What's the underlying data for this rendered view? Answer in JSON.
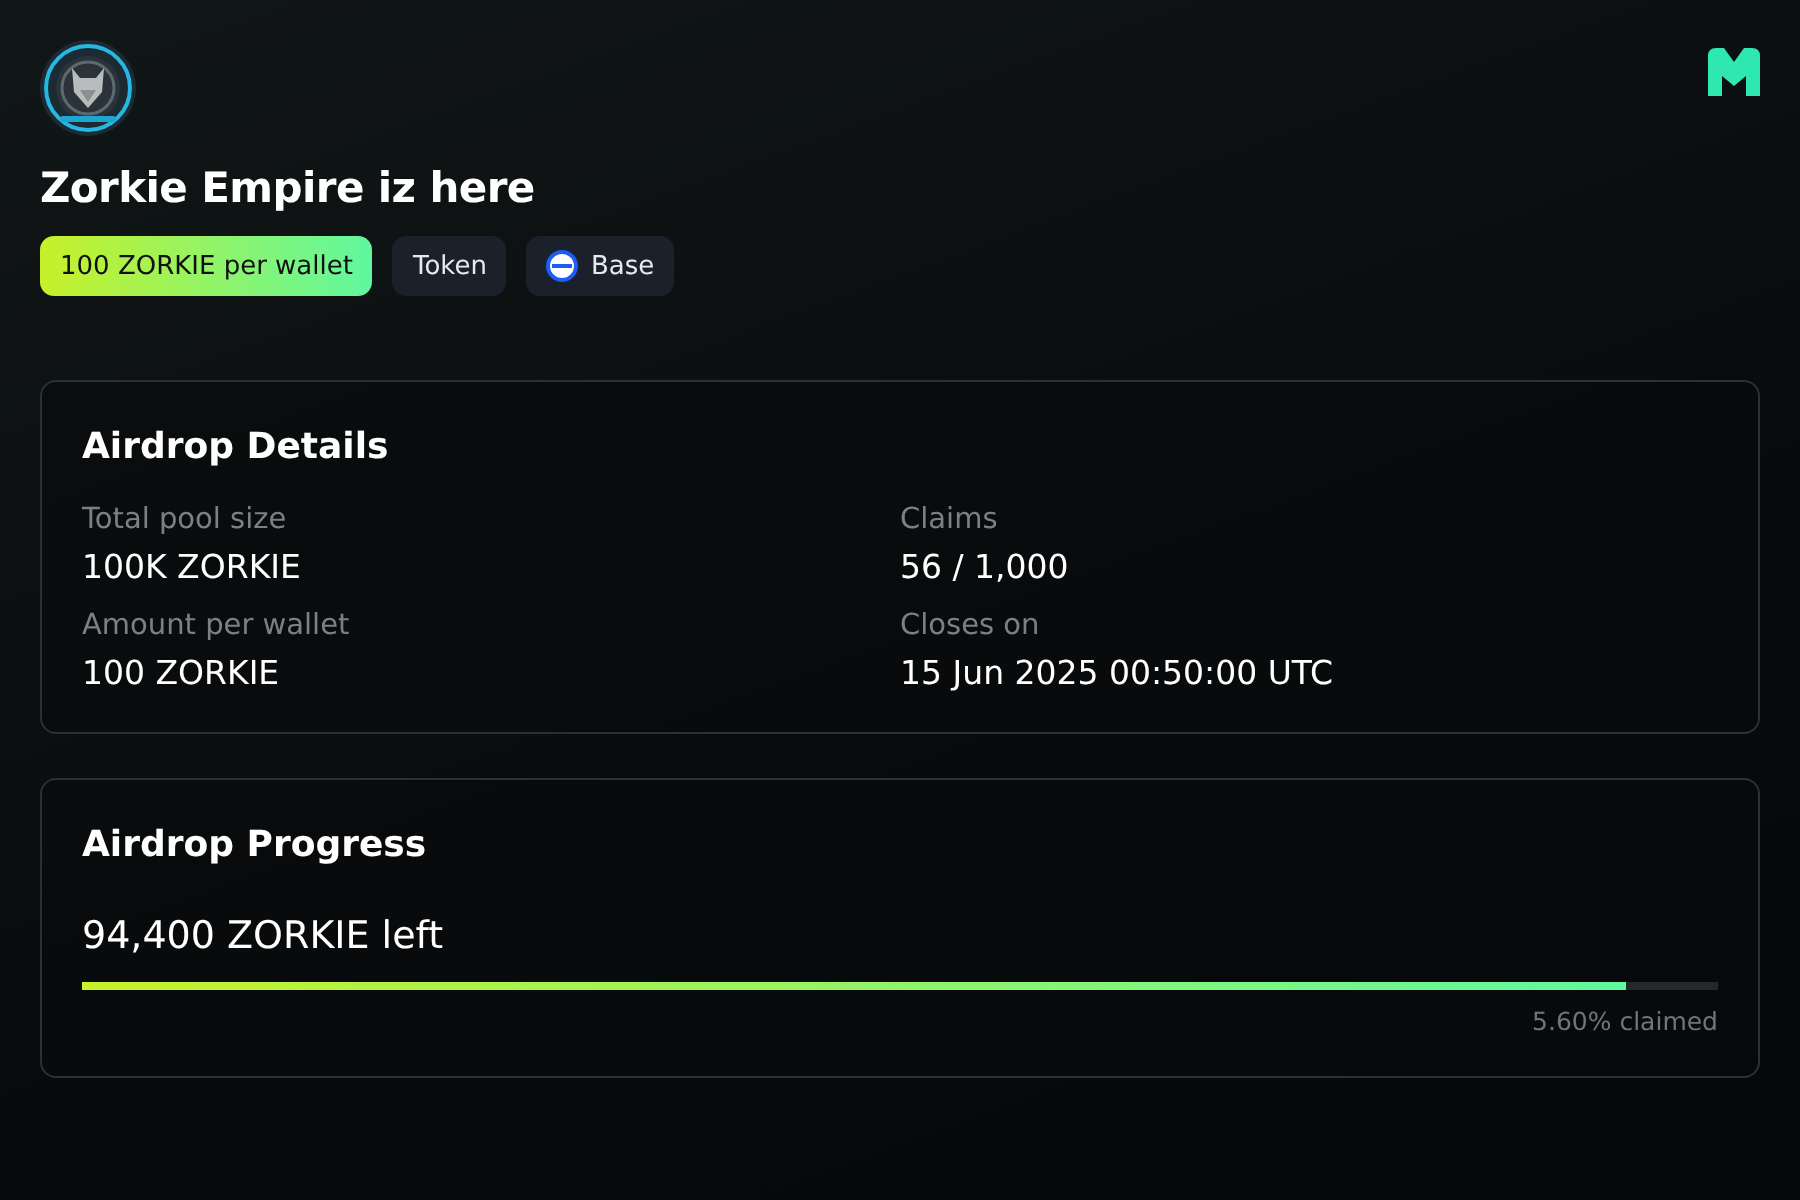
{
  "header": {
    "title": "Zorkie Empire iz here",
    "tags": [
      {
        "kind": "highlight",
        "label": "100 ZORKIE per wallet"
      },
      {
        "kind": "plain",
        "label": "Token"
      },
      {
        "kind": "chain",
        "label": "Base"
      }
    ]
  },
  "details": {
    "title": "Airdrop Details",
    "fields": [
      {
        "label": "Total pool size",
        "value": "100K ZORKIE"
      },
      {
        "label": "Claims",
        "value": "56 / 1,000"
      },
      {
        "label": "Amount per wallet",
        "value": "100 ZORKIE"
      },
      {
        "label": "Closes on",
        "value": "15 Jun 2025 00:50:00 UTC"
      }
    ]
  },
  "progress": {
    "title": "Airdrop Progress",
    "remaining": "94,400 ZORKIE left",
    "level": 0.944,
    "claimed": "5.60% claimed"
  }
}
